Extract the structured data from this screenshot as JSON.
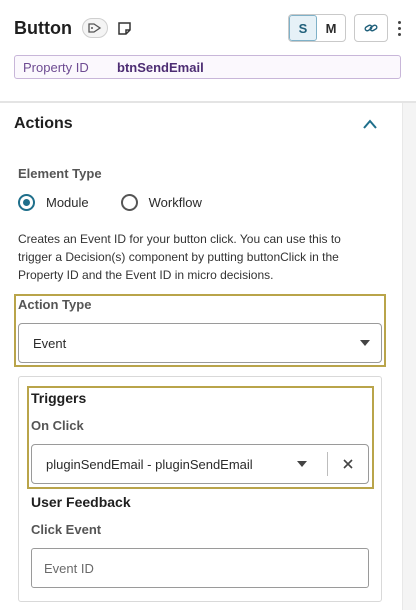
{
  "header": {
    "title": "Button",
    "size_toggle": {
      "options": [
        "S",
        "M"
      ],
      "selected": "S"
    }
  },
  "property_id": {
    "label": "Property ID",
    "value": "btnSendEmail"
  },
  "actions": {
    "title": "Actions",
    "expanded": true,
    "element_type": {
      "label": "Element Type",
      "options": [
        {
          "label": "Module",
          "selected": true
        },
        {
          "label": "Workflow",
          "selected": false
        }
      ]
    },
    "description": "Creates an Event ID for your button click. You can use this to trigger a Decision(s) component by putting buttonClick in the Property ID and the Event ID in micro decisions.",
    "action_type": {
      "label": "Action Type",
      "value": "Event"
    },
    "triggers": {
      "title": "Triggers",
      "on_click": {
        "label": "On Click",
        "value": "pluginSendEmail - pluginSendEmail"
      }
    },
    "user_feedback": {
      "title": "User Feedback",
      "click_event": {
        "label": "Click Event",
        "placeholder": "Event ID"
      }
    }
  },
  "colors": {
    "accent": "#1f6f8b",
    "highlight_border": "#b9a44a",
    "property_border": "#c8b6d9",
    "property_text": "#4d2d73"
  }
}
